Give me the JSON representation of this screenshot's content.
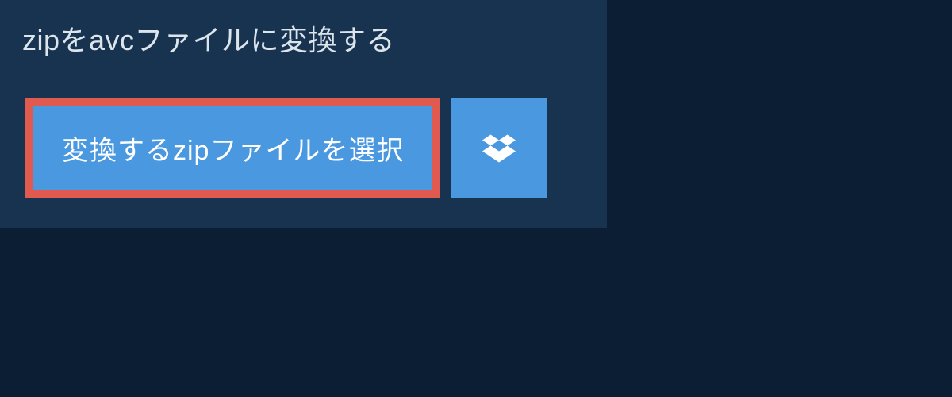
{
  "heading": "zipをavcファイルに変換する",
  "buttons": {
    "select_label": "変換するzipファイルを選択"
  }
}
